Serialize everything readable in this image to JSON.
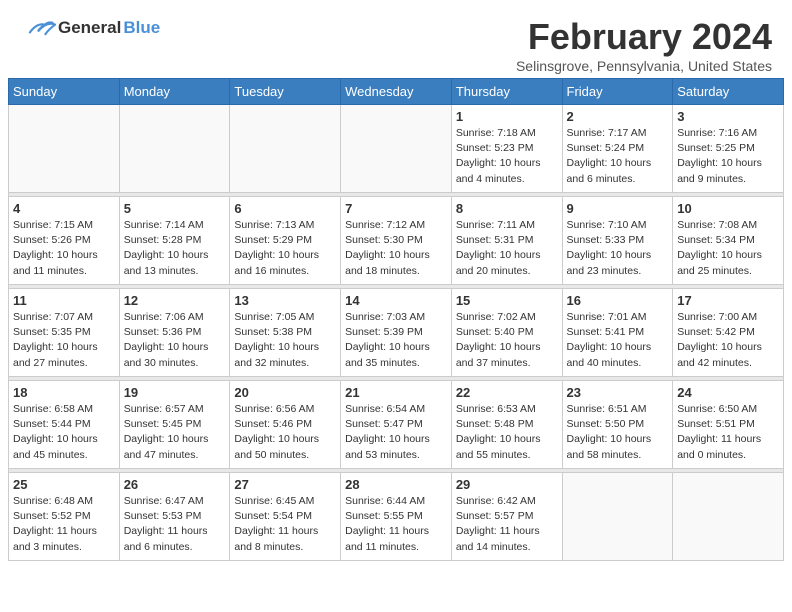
{
  "header": {
    "logo_general": "General",
    "logo_blue": "Blue",
    "month_title": "February 2024",
    "subtitle": "Selinsgrove, Pennsylvania, United States"
  },
  "columns": [
    "Sunday",
    "Monday",
    "Tuesday",
    "Wednesday",
    "Thursday",
    "Friday",
    "Saturday"
  ],
  "rows": [
    [
      {
        "day": "",
        "info": ""
      },
      {
        "day": "",
        "info": ""
      },
      {
        "day": "",
        "info": ""
      },
      {
        "day": "",
        "info": ""
      },
      {
        "day": "1",
        "info": "Sunrise: 7:18 AM\nSunset: 5:23 PM\nDaylight: 10 hours\nand 4 minutes."
      },
      {
        "day": "2",
        "info": "Sunrise: 7:17 AM\nSunset: 5:24 PM\nDaylight: 10 hours\nand 6 minutes."
      },
      {
        "day": "3",
        "info": "Sunrise: 7:16 AM\nSunset: 5:25 PM\nDaylight: 10 hours\nand 9 minutes."
      }
    ],
    [
      {
        "day": "4",
        "info": "Sunrise: 7:15 AM\nSunset: 5:26 PM\nDaylight: 10 hours\nand 11 minutes."
      },
      {
        "day": "5",
        "info": "Sunrise: 7:14 AM\nSunset: 5:28 PM\nDaylight: 10 hours\nand 13 minutes."
      },
      {
        "day": "6",
        "info": "Sunrise: 7:13 AM\nSunset: 5:29 PM\nDaylight: 10 hours\nand 16 minutes."
      },
      {
        "day": "7",
        "info": "Sunrise: 7:12 AM\nSunset: 5:30 PM\nDaylight: 10 hours\nand 18 minutes."
      },
      {
        "day": "8",
        "info": "Sunrise: 7:11 AM\nSunset: 5:31 PM\nDaylight: 10 hours\nand 20 minutes."
      },
      {
        "day": "9",
        "info": "Sunrise: 7:10 AM\nSunset: 5:33 PM\nDaylight: 10 hours\nand 23 minutes."
      },
      {
        "day": "10",
        "info": "Sunrise: 7:08 AM\nSunset: 5:34 PM\nDaylight: 10 hours\nand 25 minutes."
      }
    ],
    [
      {
        "day": "11",
        "info": "Sunrise: 7:07 AM\nSunset: 5:35 PM\nDaylight: 10 hours\nand 27 minutes."
      },
      {
        "day": "12",
        "info": "Sunrise: 7:06 AM\nSunset: 5:36 PM\nDaylight: 10 hours\nand 30 minutes."
      },
      {
        "day": "13",
        "info": "Sunrise: 7:05 AM\nSunset: 5:38 PM\nDaylight: 10 hours\nand 32 minutes."
      },
      {
        "day": "14",
        "info": "Sunrise: 7:03 AM\nSunset: 5:39 PM\nDaylight: 10 hours\nand 35 minutes."
      },
      {
        "day": "15",
        "info": "Sunrise: 7:02 AM\nSunset: 5:40 PM\nDaylight: 10 hours\nand 37 minutes."
      },
      {
        "day": "16",
        "info": "Sunrise: 7:01 AM\nSunset: 5:41 PM\nDaylight: 10 hours\nand 40 minutes."
      },
      {
        "day": "17",
        "info": "Sunrise: 7:00 AM\nSunset: 5:42 PM\nDaylight: 10 hours\nand 42 minutes."
      }
    ],
    [
      {
        "day": "18",
        "info": "Sunrise: 6:58 AM\nSunset: 5:44 PM\nDaylight: 10 hours\nand 45 minutes."
      },
      {
        "day": "19",
        "info": "Sunrise: 6:57 AM\nSunset: 5:45 PM\nDaylight: 10 hours\nand 47 minutes."
      },
      {
        "day": "20",
        "info": "Sunrise: 6:56 AM\nSunset: 5:46 PM\nDaylight: 10 hours\nand 50 minutes."
      },
      {
        "day": "21",
        "info": "Sunrise: 6:54 AM\nSunset: 5:47 PM\nDaylight: 10 hours\nand 53 minutes."
      },
      {
        "day": "22",
        "info": "Sunrise: 6:53 AM\nSunset: 5:48 PM\nDaylight: 10 hours\nand 55 minutes."
      },
      {
        "day": "23",
        "info": "Sunrise: 6:51 AM\nSunset: 5:50 PM\nDaylight: 10 hours\nand 58 minutes."
      },
      {
        "day": "24",
        "info": "Sunrise: 6:50 AM\nSunset: 5:51 PM\nDaylight: 11 hours\nand 0 minutes."
      }
    ],
    [
      {
        "day": "25",
        "info": "Sunrise: 6:48 AM\nSunset: 5:52 PM\nDaylight: 11 hours\nand 3 minutes."
      },
      {
        "day": "26",
        "info": "Sunrise: 6:47 AM\nSunset: 5:53 PM\nDaylight: 11 hours\nand 6 minutes."
      },
      {
        "day": "27",
        "info": "Sunrise: 6:45 AM\nSunset: 5:54 PM\nDaylight: 11 hours\nand 8 minutes."
      },
      {
        "day": "28",
        "info": "Sunrise: 6:44 AM\nSunset: 5:55 PM\nDaylight: 11 hours\nand 11 minutes."
      },
      {
        "day": "29",
        "info": "Sunrise: 6:42 AM\nSunset: 5:57 PM\nDaylight: 11 hours\nand 14 minutes."
      },
      {
        "day": "",
        "info": ""
      },
      {
        "day": "",
        "info": ""
      }
    ]
  ]
}
